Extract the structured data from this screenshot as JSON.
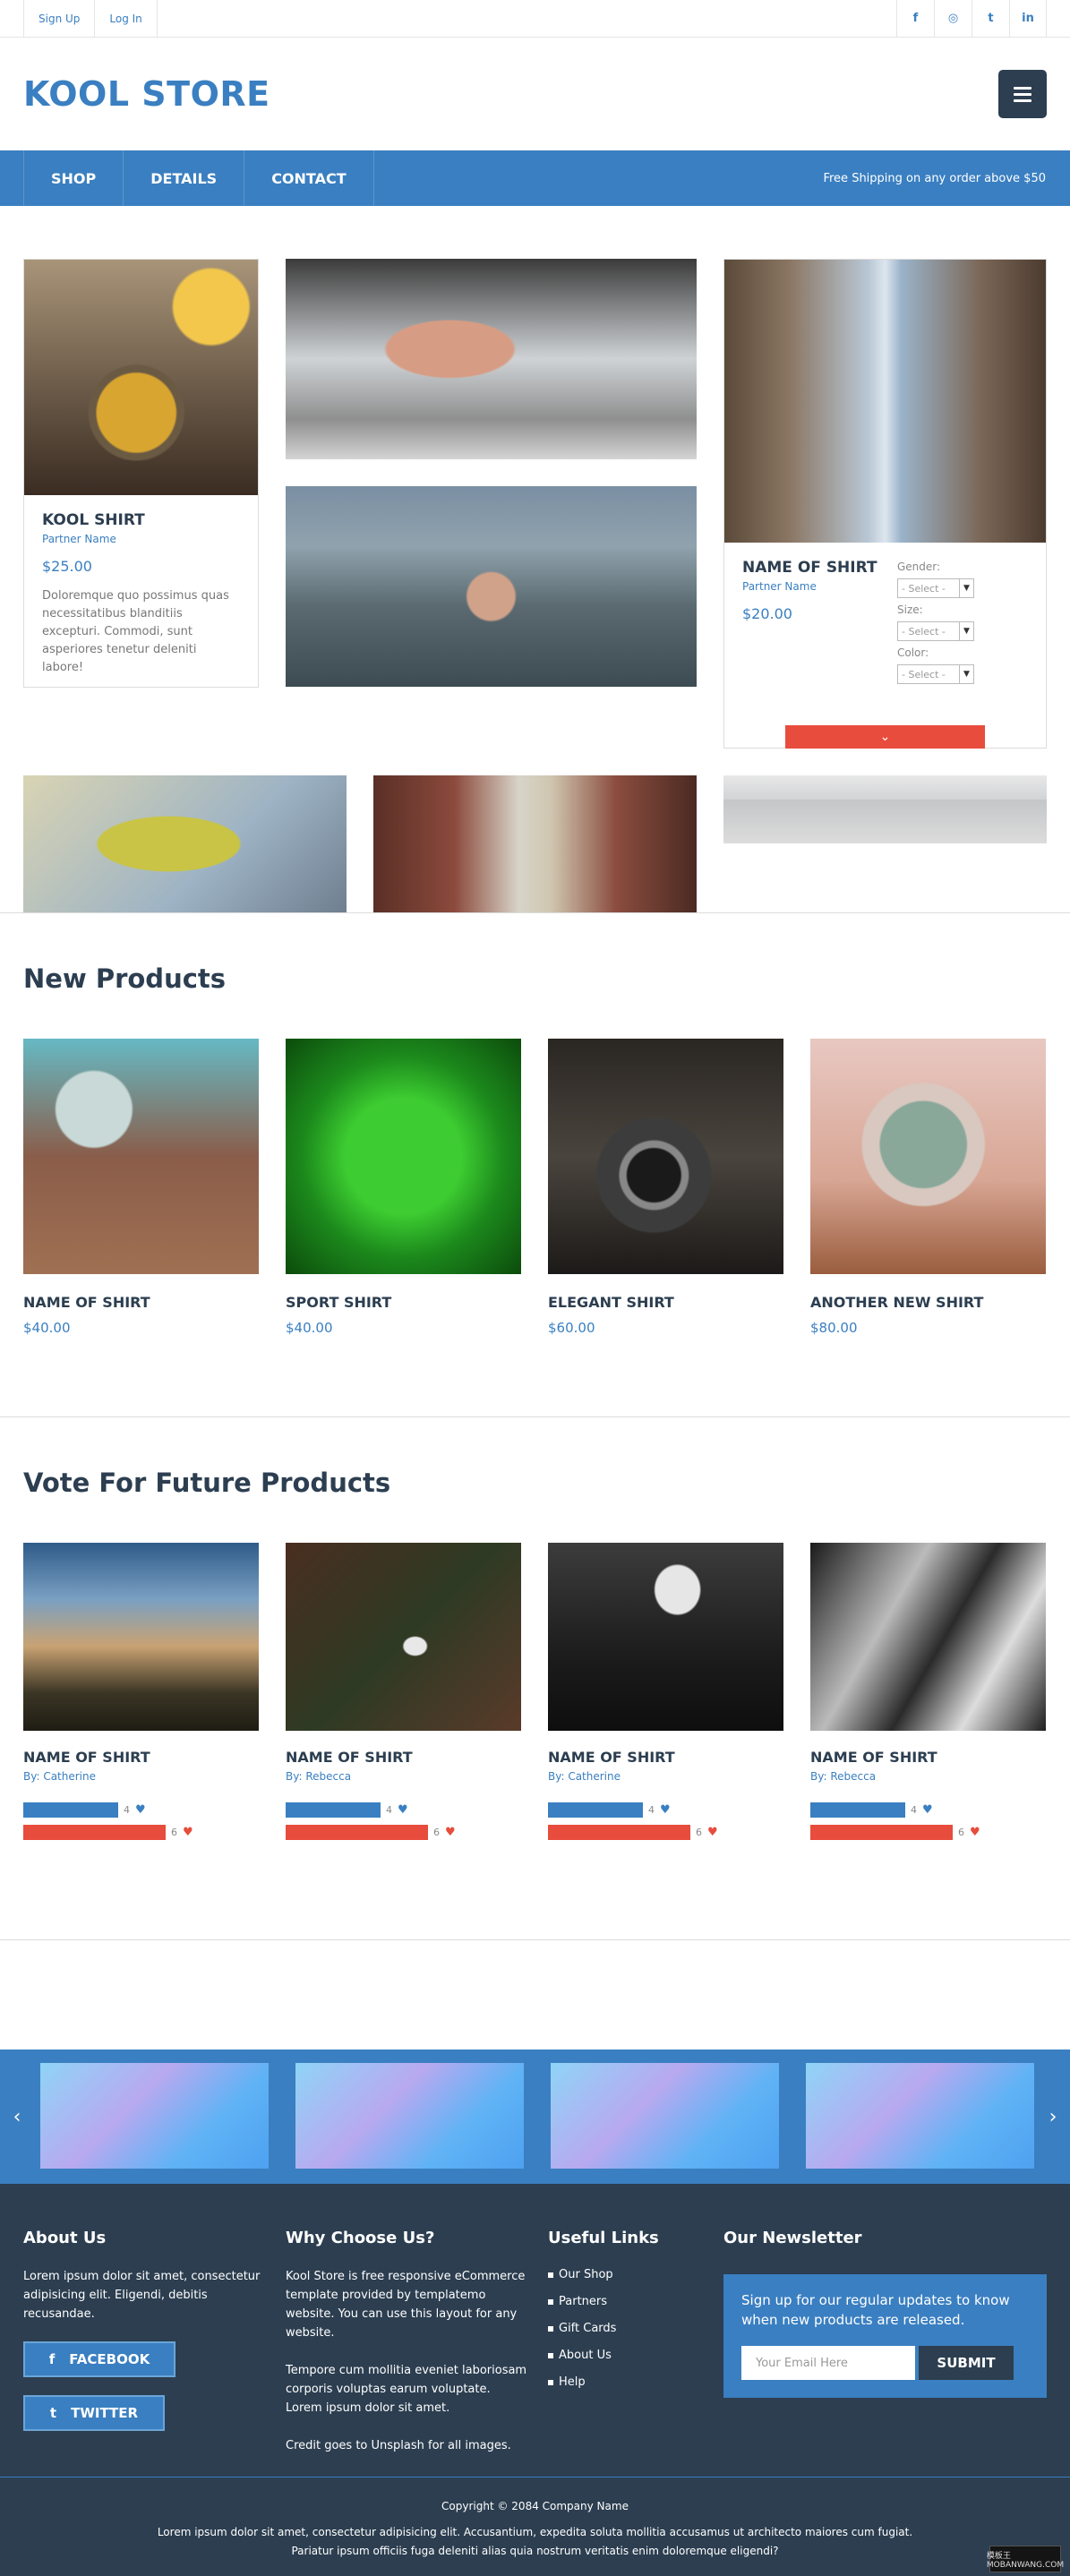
{
  "topbar": {
    "signup": "Sign Up",
    "login": "Log In",
    "social": [
      {
        "icon": "facebook-icon",
        "glyph": "f"
      },
      {
        "icon": "dribbble-icon",
        "glyph": "◎"
      },
      {
        "icon": "twitter-icon",
        "glyph": "t"
      },
      {
        "icon": "linkedin-icon",
        "glyph": "in"
      }
    ]
  },
  "header": {
    "logo": "KOOL STORE"
  },
  "nav": {
    "items": [
      "SHOP",
      "DETAILS",
      "CONTACT"
    ],
    "shipping": "Free Shipping on any order above $50"
  },
  "hero": {
    "product1": {
      "name": "KOOL SHIRT",
      "partner": "Partner Name",
      "price": "$25.00",
      "desc": "Doloremque quo possimus quas necessitatibus blanditiis excepturi. Commodi, sunt asperiores tenetur deleniti labore!"
    },
    "product2": {
      "name": "NAME OF SHIRT",
      "partner": "Partner Name",
      "price": "$20.00",
      "gender_label": "Gender:",
      "size_label": "Size:",
      "color_label": "Color:",
      "select_value": "- Select -",
      "expand_glyph": "⌄"
    }
  },
  "new_products": {
    "title": "New Products",
    "items": [
      {
        "name": "NAME OF SHIRT",
        "price": "$40.00"
      },
      {
        "name": "SPORT SHIRT",
        "price": "$40.00"
      },
      {
        "name": "ELEGANT SHIRT",
        "price": "$60.00"
      },
      {
        "name": "ANOTHER NEW SHIRT",
        "price": "$80.00"
      }
    ]
  },
  "vote": {
    "title": "Vote For Future Products",
    "items": [
      {
        "name": "NAME OF SHIRT",
        "by": "By: Catherine",
        "likes": "4",
        "dislikes": "6"
      },
      {
        "name": "NAME OF SHIRT",
        "by": "By: Rebecca",
        "likes": "4",
        "dislikes": "6"
      },
      {
        "name": "NAME OF SHIRT",
        "by": "By: Catherine",
        "likes": "4",
        "dislikes": "6"
      },
      {
        "name": "NAME OF SHIRT",
        "by": "By: Rebecca",
        "likes": "4",
        "dislikes": "6"
      }
    ]
  },
  "slider": {
    "prev": "‹",
    "next": "›"
  },
  "footer": {
    "about": {
      "title": "About Us",
      "text": "Lorem ipsum dolor sit amet, consectetur adipisicing elit. Eligendi, debitis recusandae.",
      "facebook": "FACEBOOK",
      "twitter": "TWITTER"
    },
    "why": {
      "title": "Why Choose Us?",
      "p1": "Kool Store is free responsive eCommerce template provided by templatemo website. You can use this layout for any website.",
      "p2": "Tempore cum mollitia eveniet laboriosam corporis voluptas earum voluptate. Lorem ipsum dolor sit amet.",
      "p3": "Credit goes to Unsplash for all images."
    },
    "links": {
      "title": "Useful Links",
      "items": [
        "Our Shop",
        "Partners",
        "Gift Cards",
        "About Us",
        "Help"
      ]
    },
    "newsletter": {
      "title": "Our Newsletter",
      "text": "Sign up for our regular updates to know when new products are released.",
      "placeholder": "Your Email Here",
      "submit": "SUBMIT"
    },
    "copyright": "Copyright © 2084 Company Name",
    "bottom1": "Lorem ipsum dolor sit amet, consectetur adipisicing elit. Accusantium, expedita soluta mollitia accusamus ut architecto maiores cum fugiat.",
    "bottom2": "Pariatur ipsum officiis fuga deleniti alias quia nostrum veritatis enim doloremque eligendi?",
    "stamp": "模板王 MOBANWANG.COM"
  }
}
